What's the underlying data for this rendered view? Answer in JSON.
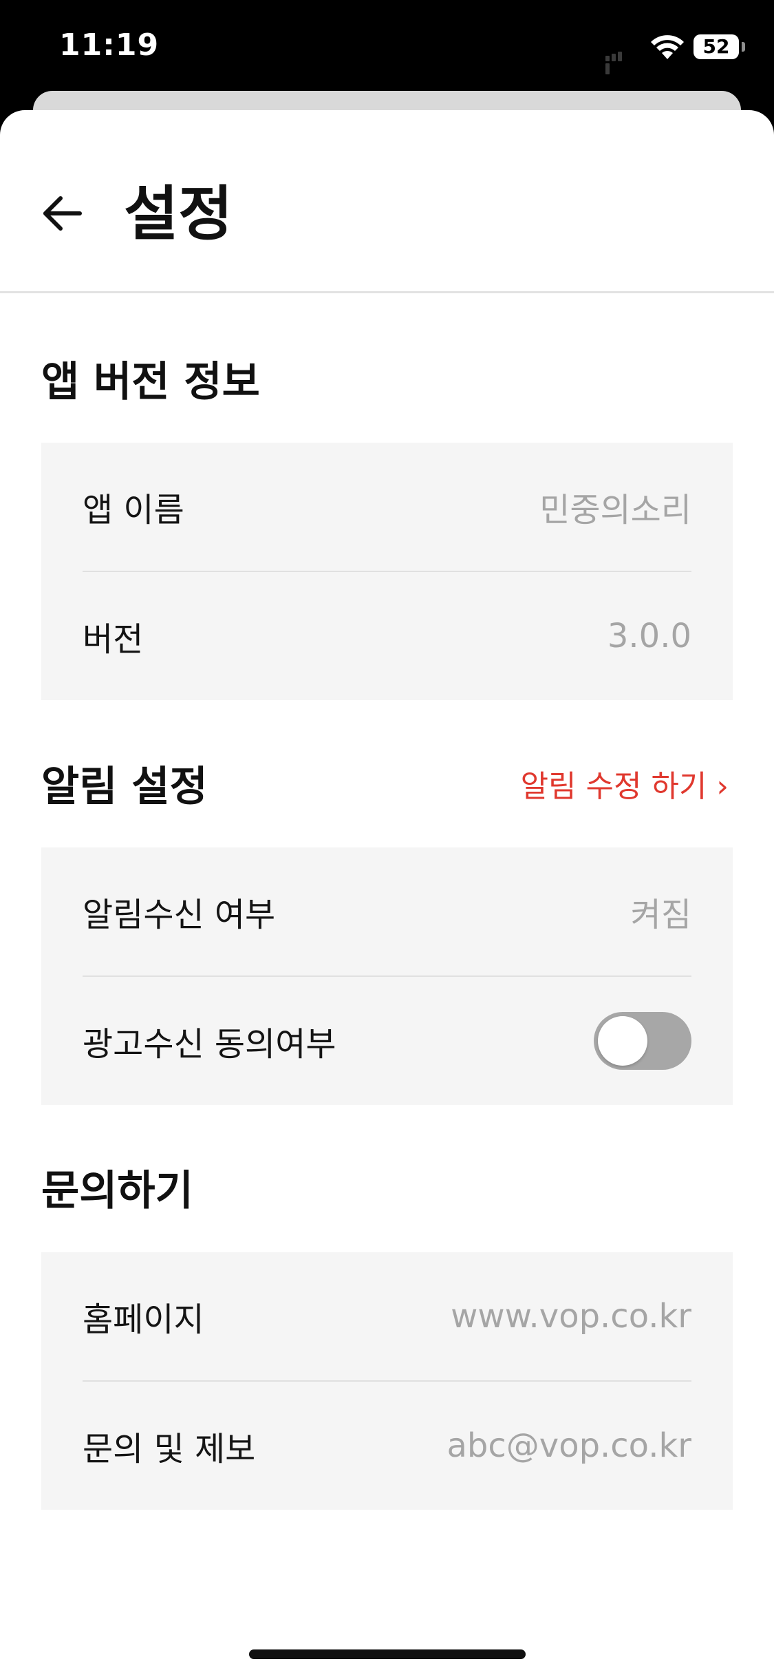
{
  "status_bar": {
    "time": "11:19",
    "battery": "52",
    "icons": [
      "signal-icon",
      "wifi-icon",
      "battery-icon"
    ]
  },
  "header": {
    "title": "설정",
    "back_icon": "arrow-left-icon"
  },
  "sections": {
    "app_info": {
      "title": "앱 버전 정보",
      "rows": [
        {
          "label": "앱 이름",
          "value": "민중의소리"
        },
        {
          "label": "버전",
          "value": "3.0.0"
        }
      ]
    },
    "notifications": {
      "title": "알림 설정",
      "edit_link": "알림 수정 하기 ›",
      "rows": [
        {
          "label": "알림수신 여부",
          "value": "켜짐"
        },
        {
          "label": "광고수신 동의여부",
          "toggle_on": false
        }
      ]
    },
    "contact": {
      "title": "문의하기",
      "rows": [
        {
          "label": "홈페이지",
          "value": "www.vop.co.kr"
        },
        {
          "label": "문의 및 제보",
          "value": "abc@vop.co.kr"
        }
      ]
    }
  },
  "colors": {
    "accent": "#e0382e",
    "group_background": "#f5f5f5",
    "value_text": "#a5a5a5",
    "toggle_off": "#a7a7a7"
  }
}
